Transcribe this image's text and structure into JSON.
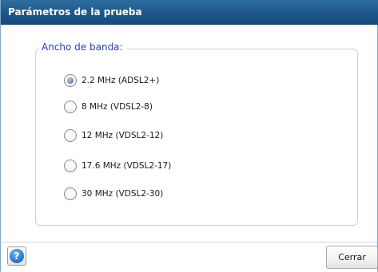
{
  "dialog": {
    "title": "Parámetros de la prueba"
  },
  "bandwidth": {
    "legend": "Ancho de banda:",
    "selected_index": 0,
    "options": [
      {
        "label": "2.2 MHz (ADSL2+)",
        "checked": true
      },
      {
        "label": "8 MHz (VDSL2-8)",
        "checked": false
      },
      {
        "label": "12 MHz (VDSL2-12)",
        "checked": false
      },
      {
        "label": "17.6 MHz (VDSL2-17)",
        "checked": false
      },
      {
        "label": "30 MHz (VDSL2-30)",
        "checked": false
      }
    ]
  },
  "footer": {
    "help_icon": "help-icon",
    "help_glyph": "?",
    "close_label": "Cerrar"
  },
  "colors": {
    "titlebar": "#1e5688",
    "legend_text": "#2b3fa8"
  }
}
